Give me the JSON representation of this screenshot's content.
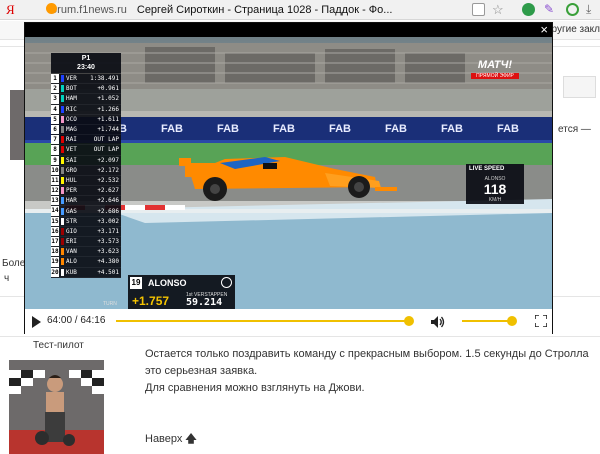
{
  "browser": {
    "logo": "Я",
    "site": "forum.f1news.ru",
    "title": "Сергей Сироткин - Страница 1028 - Паддок - Фо...",
    "other_bookmarks": "Другие закл",
    "icons": [
      "favicon",
      "read-mode-icon",
      "star-icon",
      "shield-badge-icon",
      "pen-icon",
      "refresh-icon",
      "download-icon"
    ]
  },
  "page_fragments": {
    "right_text": "ется —",
    "left_text_1": "Боле",
    "left_text_2": "ч"
  },
  "player": {
    "close_label": "×",
    "timecode": "64:00 / 64:16",
    "progress": 0.9958,
    "volume": 0.92
  },
  "broadcast": {
    "tower": {
      "lap": "P1",
      "clock": "23:40",
      "rows": [
        {
          "pos": "1",
          "code": "VER",
          "gap": "1:38.491",
          "color": "#1e41ff"
        },
        {
          "pos": "2",
          "code": "BOT",
          "gap": "+0.961",
          "color": "#00d2be"
        },
        {
          "pos": "3",
          "code": "HAM",
          "gap": "+1.052",
          "color": "#00d2be"
        },
        {
          "pos": "4",
          "code": "RIC",
          "gap": "+1.266",
          "color": "#1e41ff"
        },
        {
          "pos": "5",
          "code": "OCO",
          "gap": "+1.611",
          "color": "#f596c8"
        },
        {
          "pos": "6",
          "code": "MAG",
          "gap": "+1.744",
          "color": "#828282"
        },
        {
          "pos": "7",
          "code": "RAI",
          "gap": "OUT LAP",
          "color": "#dc0000"
        },
        {
          "pos": "8",
          "code": "VET",
          "gap": "OUT LAP",
          "color": "#dc0000"
        },
        {
          "pos": "9",
          "code": "SAI",
          "gap": "+2.097",
          "color": "#fff500"
        },
        {
          "pos": "10",
          "code": "GRO",
          "gap": "+2.172",
          "color": "#828282"
        },
        {
          "pos": "11",
          "code": "HUL",
          "gap": "+2.532",
          "color": "#fff500"
        },
        {
          "pos": "12",
          "code": "PER",
          "gap": "+2.627",
          "color": "#f596c8"
        },
        {
          "pos": "13",
          "code": "HAR",
          "gap": "+2.646",
          "color": "#469bff"
        },
        {
          "pos": "14",
          "code": "GAS",
          "gap": "+2.686",
          "color": "#469bff"
        },
        {
          "pos": "15",
          "code": "STR",
          "gap": "+3.002",
          "color": "#ffffff"
        },
        {
          "pos": "16",
          "code": "GIO",
          "gap": "+3.171",
          "color": "#9b0000"
        },
        {
          "pos": "17",
          "code": "ERI",
          "gap": "+3.573",
          "color": "#9b0000"
        },
        {
          "pos": "18",
          "code": "VAN",
          "gap": "+3.623",
          "color": "#ff8700"
        },
        {
          "pos": "19",
          "code": "ALO",
          "gap": "+4.380",
          "color": "#ff8700"
        },
        {
          "pos": "20",
          "code": "KUB",
          "gap": "+4.501",
          "color": "#ffffff"
        }
      ]
    },
    "driver": {
      "number": "19",
      "name": "ALONSO",
      "delta": "+1.757",
      "ref_label": "1st VERSTAPPEN",
      "ref_time": "59.214",
      "turn_label": "TURN"
    },
    "live_speed": {
      "title": "LIVE SPEED",
      "driver": "ALONSO",
      "value": "118",
      "unit": "KM/H"
    },
    "channel": {
      "name": "МАТЧ!",
      "sub": "ПРЯМОЙ ЭФИР"
    },
    "banners": [
      "FAB",
      "FAB",
      "FAB",
      "FAB",
      "FAB",
      "FAB",
      "FAB",
      "FAB",
      "FAB"
    ]
  },
  "post": {
    "role": "Тест-пилот",
    "lines": [
      "Остается только поздравить команду с прекрасным выбором. 1.5 секунды до Стролла",
      "это серьезная заявка.",
      "Для сравнения можно взглянуть на Джови."
    ],
    "up_label": "Наверх",
    "up_arrow": "🡅"
  },
  "colors": {
    "accent": "#f0c000",
    "mclaren_orange": "#ff8a00",
    "track_blue": "#8fb9cf"
  }
}
